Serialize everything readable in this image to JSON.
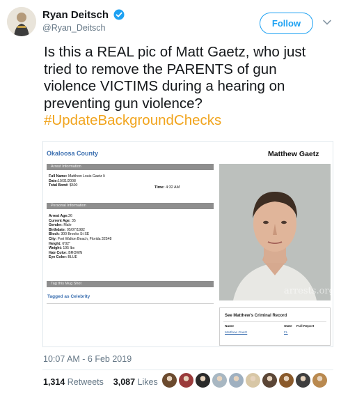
{
  "header": {
    "name": "Ryan Deitsch",
    "handle": "@Ryan_Deitsch",
    "follow_label": "Follow"
  },
  "tweet": {
    "text": "Is this a REAL pic of Matt Gaetz, who just tried to remove the PARENTS of gun violence VICTIMS during a hearing on preventing gun violence?",
    "hashtag": "#UpdateBackgroundChecks"
  },
  "media": {
    "county": "Okaloosa County",
    "person_name": "Matthew Gaetz",
    "arrest_section": "Arrest Information",
    "full_name_label": "Full Name:",
    "full_name": "Matthew Louis Gaetz Ii",
    "date_label": "Date:",
    "date": "10/31/2008",
    "bond_label": "Total Bond:",
    "bond": "$500",
    "time_label": "Time:",
    "time": "4:32 AM",
    "personal_section": "Personal Information",
    "arrest_age_label": "Arrest Age:",
    "arrest_age": "26",
    "current_age_label": "Current Age:",
    "current_age": "35",
    "gender_label": "Gender:",
    "gender": "Male",
    "birthdate_label": "Birthdate:",
    "birthdate": "05/07/1982",
    "block_label": "Block:",
    "block": "300 Brooks St SE",
    "city_label": "City:",
    "city": "Fort Walton Beach, Florida 32548",
    "height_label": "Height:",
    "height": "6'02\"",
    "weight_label": "Weight:",
    "weight": "195 lbs",
    "hair_label": "Hair Color:",
    "hair": "BROWN",
    "eye_label": "Eye Color:",
    "eye": "BLUE",
    "mugshot_section": "Tag this Mug Shot",
    "celebrity_tag": "Tagged as Celebrity",
    "watermark": "arrests.org",
    "record_title": "See Matthew's Criminal Record",
    "col_name": "Name",
    "col_state": "State",
    "col_report": "Full Report",
    "row_name": "Matthew Gaetz",
    "row_state": "FL"
  },
  "footer": {
    "timestamp": "10:07 AM - 6 Feb 2019",
    "retweets_count": "1,314",
    "retweets_label": "Retweets",
    "likes_count": "3,087",
    "likes_label": "Likes"
  },
  "colors": {
    "brand_blue": "#1da1f2",
    "hashtag": "#f1a41d",
    "muted": "#657786"
  },
  "liker_avatars": [
    "#6b4a2e",
    "#9a3b3b",
    "#2a2a2a",
    "#a8b7c2",
    "#9fb0c0",
    "#d8c7a6",
    "#5b4636",
    "#8a5a2b",
    "#3e3e3e",
    "#b9894f"
  ]
}
